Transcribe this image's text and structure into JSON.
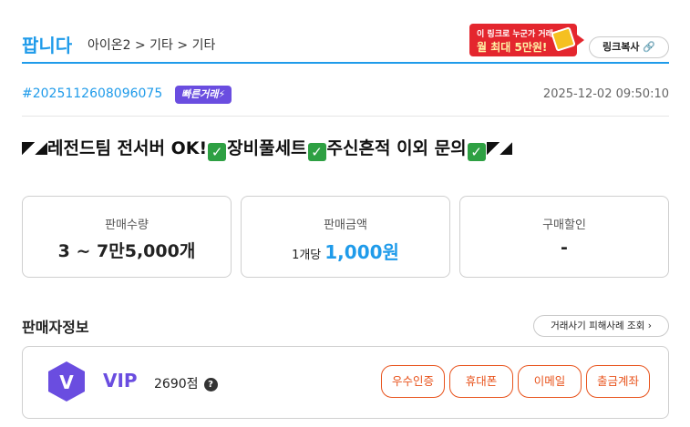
{
  "header": {
    "brand": "팝니다",
    "breadcrumb": "아이온2 > 기타 > 기타",
    "promo_line1": "이 링크로 누군가 거래 시",
    "promo_line2": "월 최대 5만원!",
    "copy_link": "링크복사 🔗"
  },
  "meta": {
    "trade_id": "#2025112608096075",
    "fast_badge": "빠른거래⚡",
    "timestamp": "2025-12-02 09:50:10"
  },
  "title": {
    "part1": "레전드팀 전서버 OK!",
    "part2": "장비풀세트",
    "part3": "주신흔적 이외 문의",
    "check": "✓"
  },
  "cards": [
    {
      "label": "판매수량",
      "value": "3 ~ 7만5,000개"
    },
    {
      "label": "판매금액",
      "unit": "1개당",
      "value": "1,000원"
    },
    {
      "label": "구매할인",
      "value": "-"
    }
  ],
  "seller": {
    "section_title": "판매자정보",
    "fraud_button": "거래사기 피해사례 조회 ›",
    "grade_letter": "V",
    "grade": "VIP",
    "points": "2690점",
    "help": "?",
    "verifications": [
      "우수인증",
      "휴대폰",
      "이메일",
      "출금계좌"
    ]
  },
  "colors": {
    "accent": "#1f9bea",
    "vip": "#6a4de0",
    "verify": "#e8531c",
    "promo": "#e4262e"
  }
}
